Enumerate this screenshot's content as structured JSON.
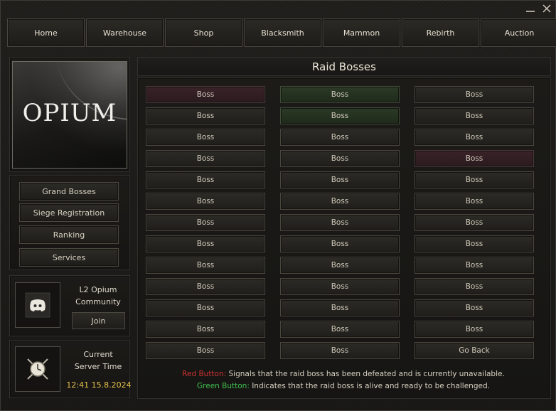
{
  "window": {
    "minimize_icon": "minimize-icon",
    "close_icon": "close-icon"
  },
  "nav": {
    "items": [
      "Home",
      "Warehouse",
      "Shop",
      "Blacksmith",
      "Mammon",
      "Rebirth",
      "Auction"
    ]
  },
  "sidebar": {
    "logo_text": "OPIUM",
    "menu": [
      "Grand Bosses",
      "Siege Registration",
      "Ranking",
      "Services"
    ],
    "community": {
      "icon": "discord-icon",
      "line1": "L2 Opium",
      "line2": "Community",
      "join_label": "Join"
    },
    "server_time": {
      "icon": "clock-swords-icon",
      "line1": "Current",
      "line2": "Server Time",
      "value": "12:41 15.8.2024"
    }
  },
  "main": {
    "title": "Raid Bosses",
    "columns": [
      [
        {
          "label": "Boss",
          "state": "red"
        },
        {
          "label": "Boss",
          "state": "normal"
        },
        {
          "label": "Boss",
          "state": "normal"
        },
        {
          "label": "Boss",
          "state": "normal"
        },
        {
          "label": "Boss",
          "state": "normal"
        },
        {
          "label": "Boss",
          "state": "normal"
        },
        {
          "label": "Boss",
          "state": "normal"
        },
        {
          "label": "Boss",
          "state": "normal"
        },
        {
          "label": "Boss",
          "state": "normal"
        },
        {
          "label": "Boss",
          "state": "normal"
        },
        {
          "label": "Boss",
          "state": "normal"
        },
        {
          "label": "Boss",
          "state": "normal"
        },
        {
          "label": "Boss",
          "state": "normal"
        }
      ],
      [
        {
          "label": "Boss",
          "state": "green"
        },
        {
          "label": "Boss",
          "state": "green"
        },
        {
          "label": "Boss",
          "state": "normal"
        },
        {
          "label": "Boss",
          "state": "normal"
        },
        {
          "label": "Boss",
          "state": "normal"
        },
        {
          "label": "Boss",
          "state": "normal"
        },
        {
          "label": "Boss",
          "state": "normal"
        },
        {
          "label": "Boss",
          "state": "normal"
        },
        {
          "label": "Boss",
          "state": "normal"
        },
        {
          "label": "Boss",
          "state": "normal"
        },
        {
          "label": "Boss",
          "state": "normal"
        },
        {
          "label": "Boss",
          "state": "normal"
        },
        {
          "label": "Boss",
          "state": "normal"
        }
      ],
      [
        {
          "label": "Boss",
          "state": "normal"
        },
        {
          "label": "Boss",
          "state": "normal"
        },
        {
          "label": "Boss",
          "state": "normal"
        },
        {
          "label": "Boss",
          "state": "red"
        },
        {
          "label": "Boss",
          "state": "normal"
        },
        {
          "label": "Boss",
          "state": "normal"
        },
        {
          "label": "Boss",
          "state": "normal"
        },
        {
          "label": "Boss",
          "state": "normal"
        },
        {
          "label": "Boss",
          "state": "normal"
        },
        {
          "label": "Boss",
          "state": "normal"
        },
        {
          "label": "Boss",
          "state": "normal"
        },
        {
          "label": "Boss",
          "state": "normal"
        },
        {
          "label": "Go Back",
          "state": "normal"
        }
      ]
    ],
    "legend": {
      "red_label": "Red Button:",
      "red_text": " Signals that the raid boss has been defeated and is currently unavailable.",
      "green_label": "Green Button:",
      "green_text": " Indicates that the raid boss is alive and ready to be challenged."
    }
  },
  "colors": {
    "red_state": "#cc3333",
    "green_state": "#3fbf4f",
    "time_color": "#e8c24a"
  }
}
